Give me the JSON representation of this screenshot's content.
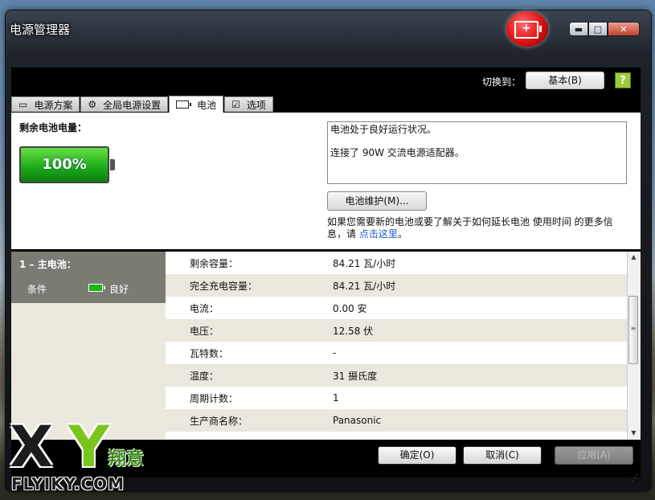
{
  "window": {
    "title": "电源管理器",
    "minimize_glyph": "▬",
    "maximize_glyph": "□",
    "close_glyph": "✕"
  },
  "toolbar": {
    "switch_label": "切换到：",
    "switch_button": "基本(B)",
    "help_glyph": "?"
  },
  "tabs": [
    {
      "label": "电源方案",
      "icon": "power-plan-icon",
      "active": false
    },
    {
      "label": "全局电源设置",
      "icon": "gear-icon",
      "active": false
    },
    {
      "label": "电池",
      "icon": "battery-icon",
      "active": true
    },
    {
      "label": "选项",
      "icon": "checkbox-icon",
      "active": false
    }
  ],
  "battery_summary": {
    "label": "剩余电池电量：",
    "percent_text": "100%",
    "charge_level": 1.0
  },
  "status": {
    "line1": "电池处于良好运行状况。",
    "line2": "连接了 90W 交流电源适配器。"
  },
  "maintenance_button": "电池维护(M)...",
  "info": {
    "text": "如果您需要新的电池或要了解关于如何延长电池 使用时间 的更多信息，请 ",
    "link": "点击这里",
    "suffix": "。"
  },
  "battery_panel": {
    "title": "1 – 主电池：",
    "condition_label": "条件",
    "condition_value": "良好"
  },
  "details": [
    {
      "label": "剩余容量：",
      "value": "84.21 瓦/小时"
    },
    {
      "label": "完全充电容量：",
      "value": "84.21 瓦/小时"
    },
    {
      "label": "电流：",
      "value": "0.00 安"
    },
    {
      "label": "电压：",
      "value": "12.58 伏"
    },
    {
      "label": "瓦特数：",
      "value": "-"
    },
    {
      "label": "温度：",
      "value": "31 摄氏度"
    },
    {
      "label": "周期计数：",
      "value": "1"
    },
    {
      "label": "生产商名称：",
      "value": "Panasonic"
    }
  ],
  "buttons": {
    "ok": "确定(O)",
    "cancel": "取消(C)",
    "apply": "应用(A)"
  },
  "watermark": {
    "x": "X",
    "y": "Y",
    "cn": "翔意",
    "url": "FLYIKY.COM"
  },
  "colors": {
    "battery_green": "#1aa91a",
    "link_blue": "#1a5fc7",
    "row_alt": "#eae7dd"
  }
}
